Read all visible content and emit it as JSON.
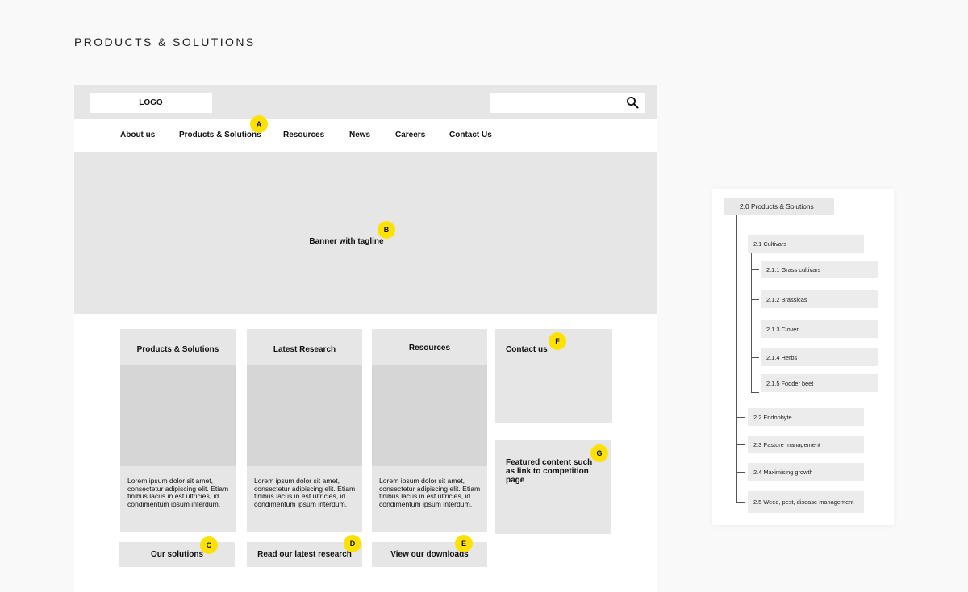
{
  "page_heading": "PRODUCTS & SOLUTIONS",
  "header": {
    "logo_label": "LOGO",
    "search_placeholder": ""
  },
  "nav": {
    "items": [
      "About us",
      "Products & Solutions",
      "Resources",
      "News",
      "Careers",
      "Contact Us"
    ]
  },
  "banner": {
    "text": "Banner with tagline"
  },
  "cards": [
    {
      "title": "Products & Solutions",
      "body": "Lorem ipsum dolor sit amet, consectetur adipiscing elit. Etiam finibus lacus in est ultricies, id condimentum ipsum interdum.",
      "cta": "Our solutions"
    },
    {
      "title": "Latest Research",
      "body": "Lorem ipsum dolor sit amet, consectetur adipiscing elit. Etiam finibus lacus in est ultricies, id condimentum ipsum interdum.",
      "cta": "Read our latest research"
    },
    {
      "title": "Resources",
      "body": "Lorem ipsum dolor sit amet, consectetur adipiscing elit. Etiam finibus lacus in est ultricies, id condimentum ipsum interdum.",
      "cta": "View our downloads"
    }
  ],
  "sidebar": {
    "contact_title": "Contact us",
    "featured_text": "Featured content such as link to competition page"
  },
  "badges": [
    "A",
    "B",
    "C",
    "D",
    "E",
    "F",
    "G"
  ],
  "sitemap": {
    "root": "2.0 Products & Solutions",
    "items": [
      {
        "label": "2.1 Cultivars",
        "children": [
          "2.1.1 Grass cultivars",
          "2.1.2 Brassicas",
          "2.1.3 Clover",
          "2.1.4 Herbs",
          "2.1.5 Fodder beet"
        ]
      },
      {
        "label": "2.2 Endophyte",
        "children": []
      },
      {
        "label": "2.3 Pasture management",
        "children": []
      },
      {
        "label": "2.4 Maximising growth",
        "children": []
      },
      {
        "label": "2.5 Weed, pest, disease management",
        "children": []
      }
    ]
  },
  "colors": {
    "page_bg": "#f9f9f9",
    "panel_bg": "#e6e6e6",
    "image_placeholder": "#d6d6d6",
    "badge": "#ffe100"
  }
}
